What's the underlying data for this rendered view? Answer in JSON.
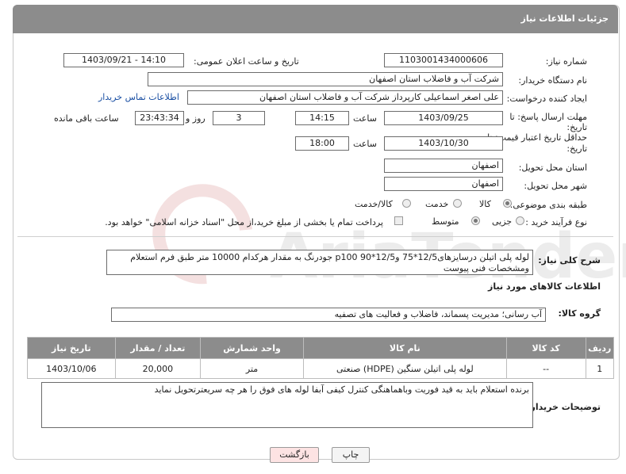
{
  "header": {
    "title": "جزئیات اطلاعات نیاز"
  },
  "fields": {
    "need_number_label": "شماره نیاز:",
    "need_number": "1103001434000606",
    "announce_label": "تاریخ و ساعت اعلان عمومی:",
    "announce_value": "1403/09/21 - 14:10",
    "buyer_label": "نام دستگاه خریدار:",
    "buyer_value": "شرکت آب و فاضلاب استان اصفهان",
    "creator_label": "ایجاد کننده درخواست:",
    "creator_value": "علی اصغر اسماعیلی کارپرداز شرکت آب و فاضلاب استان اصفهان",
    "contact_link": "اطلاعات تماس خریدار",
    "deadline_label_1": "مهلت ارسال پاسخ: تا",
    "deadline_label_2": "تاریخ:",
    "deadline_date": "1403/09/25",
    "time_label": "ساعت",
    "deadline_time": "14:15",
    "days_value": "3",
    "days_label": "روز و",
    "remaining_time": "23:43:34",
    "remaining_label": "ساعت باقی مانده",
    "validity_label_1": "حداقل تاریخ اعتبار قیمت: تا",
    "validity_label_2": "تاریخ:",
    "validity_date": "1403/10/30",
    "validity_time_label": "ساعت",
    "validity_time": "18:00",
    "province_label": "استان محل تحویل:",
    "province_value": "اصفهان",
    "city_label": "شهر محل تحویل:",
    "city_value": "اصفهان",
    "category_label": "طبقه بندی موضوعی:",
    "category_options": [
      "کالا",
      "خدمت",
      "کالا/خدمت"
    ],
    "process_label": "نوع فرآیند خرید :",
    "process_options": [
      "جزیی",
      "متوسط"
    ],
    "payment_note": "پرداخت تمام یا بخشی از مبلغ خرید،از محل \"اسناد خزانه اسلامی\" خواهد بود."
  },
  "summary": {
    "label": "شرح کلی نیاز:",
    "text": "لوله پلی اتیلن درسایزهای12/5*75 و12/5*90 p100 جودرنگ به مقدار هرکدام 10000 متر طبق فرم استعلام ومشخصات فنی پیوست"
  },
  "goods_section": {
    "title": "اطلاعات کالاهای مورد نیاز",
    "group_label": "گروه کالا:",
    "group_value": "آب رسانی؛ مدیریت پسماند، فاضلاب و فعالیت های تصفیه"
  },
  "table": {
    "headers": [
      "ردیف",
      "کد کالا",
      "نام کالا",
      "واحد شمارش",
      "تعداد / مقدار",
      "تاریخ نیاز"
    ],
    "rows": [
      [
        "1",
        "--",
        "لوله پلی اتیلن سنگین (HDPE) صنعتی",
        "متر",
        "20,000",
        "1403/10/06"
      ]
    ]
  },
  "buyer_notes": {
    "label": "توضیحات خریدار:",
    "text": "برنده استعلام باید به قید فوریت وباهماهنگی کنترل کیفی آبفا لوله های فوق را هر چه سریعترتحویل نماید"
  },
  "buttons": {
    "print": "چاپ",
    "back": "بازگشت"
  },
  "colors": {
    "header_bg": "#8c8c8c",
    "link": "#1a4fa3",
    "back_button_bg": "#fde3e3"
  }
}
